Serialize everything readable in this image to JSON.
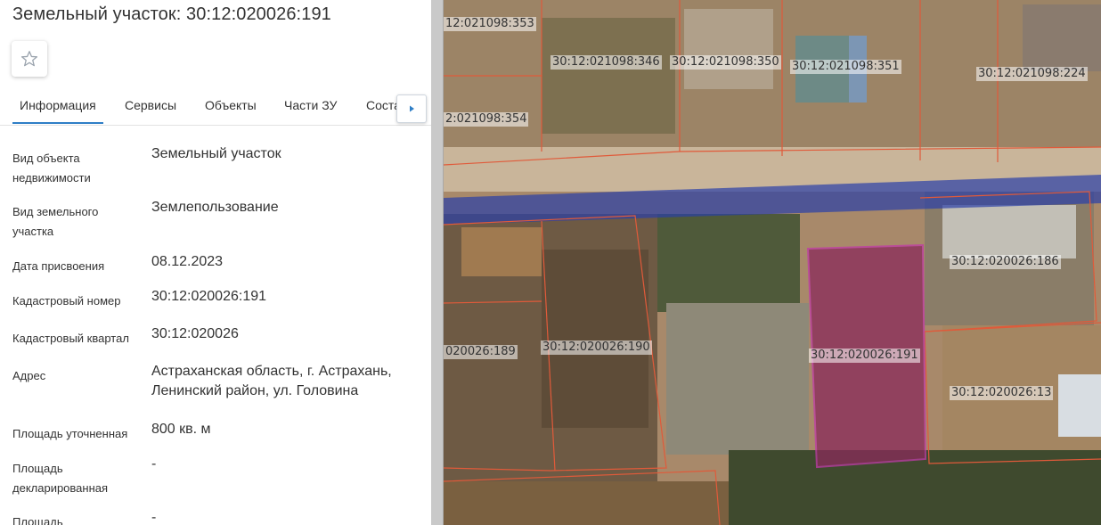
{
  "panel": {
    "title": "Земельный участок: 30:12:020026:191",
    "favorite_icon": "star-outline-icon",
    "tabs": [
      "Информация",
      "Сервисы",
      "Объекты",
      "Части ЗУ",
      "Состав ЗУ"
    ],
    "active_tab": "Информация",
    "scroll_next_icon": "triangle-right-icon",
    "fields": [
      {
        "label": "Вид объекта недвижимости",
        "value": "Земельный участок"
      },
      {
        "label": "Вид земельного участка",
        "value": "Землепользование"
      },
      {
        "label": "Дата присвоения",
        "value": "08.12.2023"
      },
      {
        "label": "Кадастровый номер",
        "value": "30:12:020026:191"
      },
      {
        "label": "Кадастровый квартал",
        "value": "30:12:020026"
      },
      {
        "label": "Адрес",
        "value": "Астраханская область, г. Астрахань, Ленинский район, ул. Головина"
      },
      {
        "label": "Площадь уточненная",
        "value": "800 кв. м"
      },
      {
        "label": "Площадь декларированная",
        "value": "-"
      },
      {
        "label": "Площадь",
        "value": "-"
      }
    ]
  },
  "map": {
    "parcel_labels": [
      "12:021098:353",
      "30:12:021098:346",
      "30:12:021098:350",
      "30:12:021098:351",
      "30:12:021098:224",
      "2:021098:354",
      "30:12:020026:186",
      "020026:189",
      "30:12:020026:190",
      "30:12:020026:191",
      "30:12:020026:13"
    ],
    "colors": {
      "parcel_border": "#e05a3a",
      "selected_fill": "#8a2a5a",
      "selected_border": "#c03aa8",
      "road_overlay": "#2a3fa8"
    }
  }
}
